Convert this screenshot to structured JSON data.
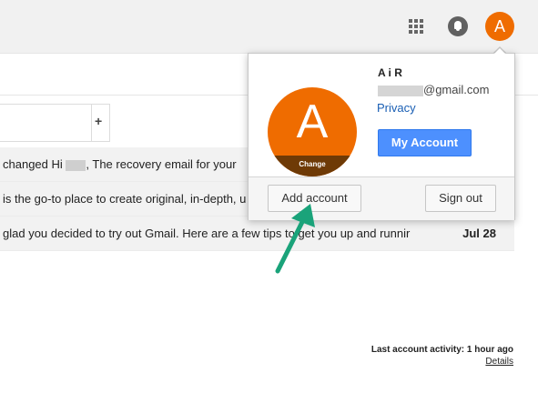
{
  "header": {
    "apps_icon": "apps-grid-icon",
    "notifications_icon": "bell-icon",
    "avatar_letter": "A",
    "accent": "#ef6c00"
  },
  "tabs": {
    "add_label": "+"
  },
  "messages": [
    {
      "snippet_a": "changed Hi ",
      "snippet_b": ", The recovery email for your",
      "date": ""
    },
    {
      "snippet_a": "is the go-to place to create original, in-depth, u",
      "snippet_b": "",
      "date": ""
    },
    {
      "snippet_a": "glad you decided to try out Gmail. Here are a few tips to get you up and runnir",
      "snippet_b": "",
      "date": "Jul 28"
    }
  ],
  "activity": {
    "text": "Last account activity: 1 hour ago",
    "details_label": "Details"
  },
  "account_popup": {
    "avatar_letter": "A",
    "change_label": "Change",
    "name": "A    i R",
    "email_suffix": "@gmail.com",
    "privacy_label": "Privacy",
    "my_account_label": "My Account",
    "add_account_label": "Add account",
    "sign_out_label": "Sign out",
    "button_color": "#4d90fe"
  },
  "annotation": {
    "arrow_color": "#1aa37a"
  }
}
